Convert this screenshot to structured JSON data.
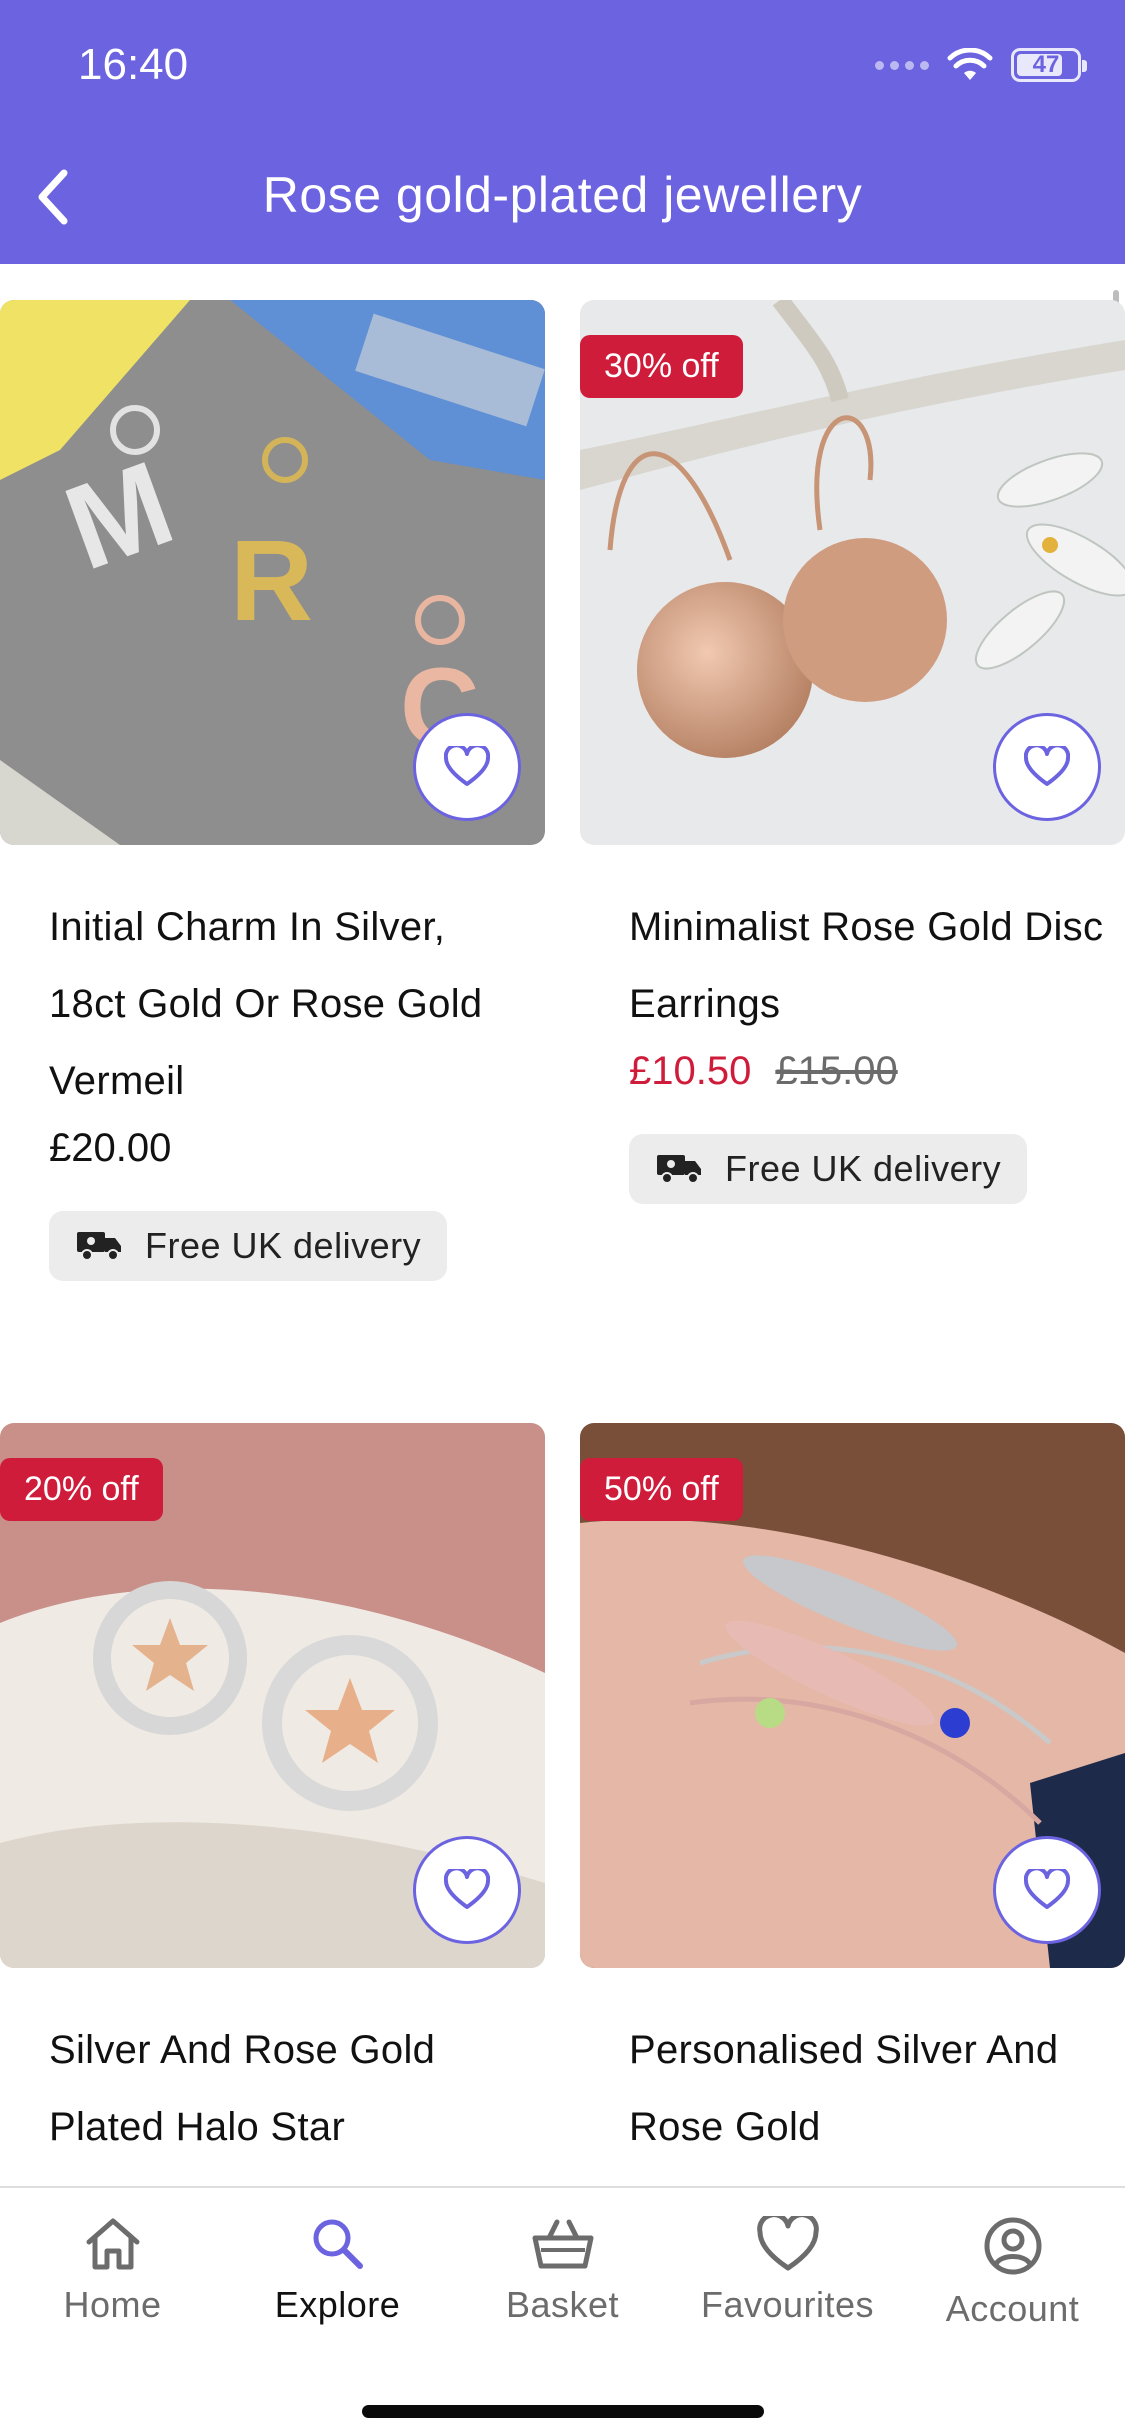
{
  "status": {
    "time": "16:40",
    "battery": "47"
  },
  "header": {
    "title": "Rose gold-plated jewellery"
  },
  "products": [
    {
      "title": "Initial Charm In Silver, 18ct Gold Or Rose Gold Vermeil",
      "price": "£20.00",
      "delivery": "Free UK delivery"
    },
    {
      "badge": "30% off",
      "title": "Minimalist Rose Gold Disc Earrings",
      "sale_price": "£10.50",
      "original_price": "£15.00",
      "delivery": "Free UK delivery"
    },
    {
      "badge": "20% off",
      "title": "Silver And Rose Gold Plated Halo Star"
    },
    {
      "badge": "50% off",
      "title": "Personalised Silver And Rose Gold"
    }
  ],
  "tabs": [
    {
      "label": "Home",
      "icon": "home-icon"
    },
    {
      "label": "Explore",
      "icon": "search-icon",
      "active": true
    },
    {
      "label": "Basket",
      "icon": "basket-icon"
    },
    {
      "label": "Favourites",
      "icon": "heart-icon"
    },
    {
      "label": "Account",
      "icon": "account-icon"
    }
  ],
  "colors": {
    "brand": "#6c63e0",
    "sale": "#d01c3b"
  }
}
